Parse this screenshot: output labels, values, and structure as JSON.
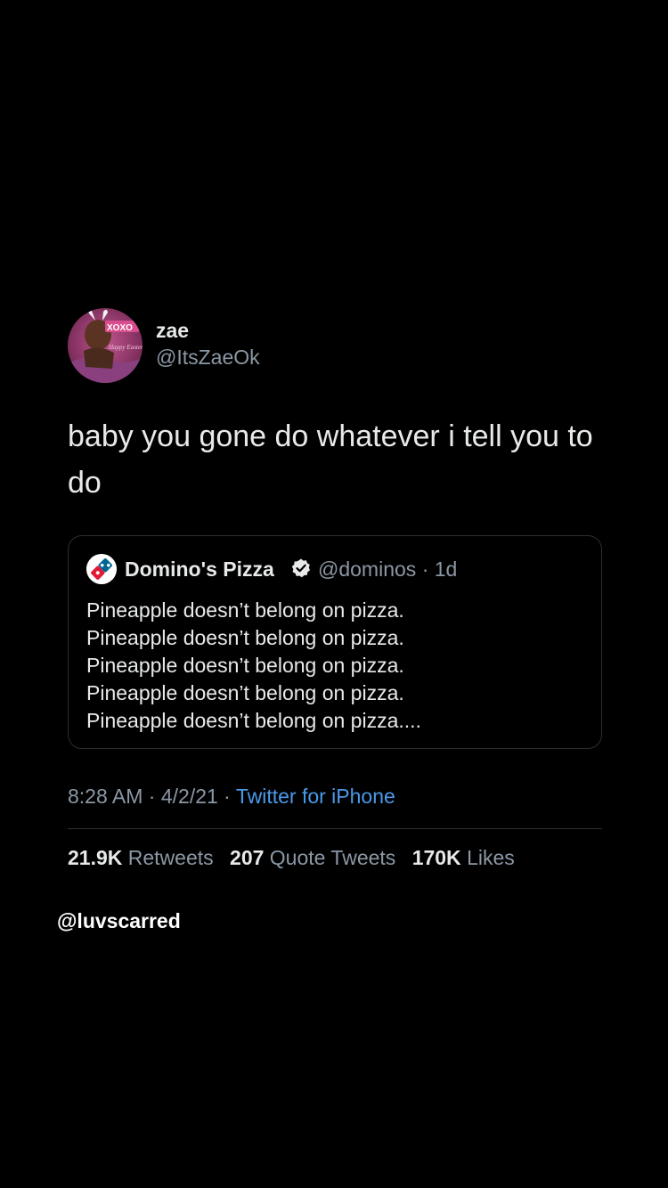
{
  "tweet": {
    "author": {
      "name": "zae",
      "handle": "@ItsZaeOk",
      "avatar_icon": "profile-photo-avatar",
      "avatar_text": [
        "XOXO",
        "Happy Easter"
      ]
    },
    "text": "baby you gone do whatever i tell you to do",
    "quote": {
      "author_name": "Domino's Pizza",
      "verified_icon": "verified-badge-icon",
      "handle": "@dominos",
      "separator": "·",
      "age": "1d",
      "avatar_icon": "dominos-logo-icon",
      "lines": [
        "Pineapple doesn’t belong on pizza.",
        "Pineapple doesn’t belong on pizza.",
        "Pineapple doesn’t belong on pizza.",
        "Pineapple doesn’t belong on pizza.",
        "Pineapple doesn’t belong on pizza...."
      ]
    },
    "meta": {
      "time": "8:28 AM",
      "separator": " · ",
      "date": "4/2/21",
      "source": "Twitter for iPhone"
    },
    "stats": {
      "retweets_count": "21.9K",
      "retweets_label": "Retweets",
      "quotes_count": "207",
      "quotes_label": "Quote Tweets",
      "likes_count": "170K",
      "likes_label": "Likes"
    }
  },
  "watermark": "@luvscarred",
  "colors": {
    "background": "#000000",
    "text_primary": "#e7e9ea",
    "text_secondary": "#8b98a5",
    "link": "#4a99e9",
    "border": "#2a2f33",
    "dominos_blue": "#006491",
    "dominos_red": "#e31837"
  }
}
